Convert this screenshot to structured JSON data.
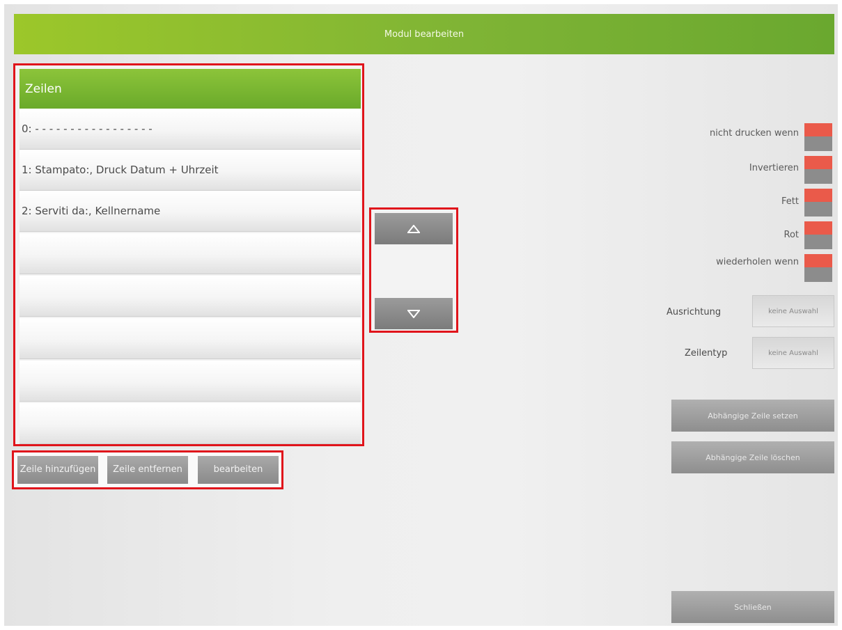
{
  "window": {
    "title": "Modul bearbeiten"
  },
  "lines": {
    "header": "Zeilen",
    "rows": [
      "0: - - - - - - - - - - - - - - - - -",
      "1: Stampato:, Druck Datum + Uhrzeit",
      "2: Serviti da:, Kellnername",
      "",
      "",
      "",
      "",
      ""
    ]
  },
  "row_actions": {
    "add": "Zeile hinzufügen",
    "remove": "Zeile entfernen",
    "edit": "bearbeiten"
  },
  "move_buttons": {
    "up_icon": "chevron-up-icon",
    "down_icon": "chevron-down-icon"
  },
  "options": {
    "toggles": [
      {
        "label": "nicht drucken wenn"
      },
      {
        "label": "Invertieren"
      },
      {
        "label": "Fett"
      },
      {
        "label": "Rot"
      },
      {
        "label": "wiederholen wenn"
      }
    ],
    "toggle_on_color": "#ea5a4a",
    "toggle_off_color": "#8c8c8c",
    "alignment": {
      "label": "Ausrichtung",
      "value": "keine Auswahl"
    },
    "line_type": {
      "label": "Zeilentyp",
      "value": "keine Auswahl"
    },
    "set_dependent": "Abhängige Zeile setzen",
    "delete_dependent": "Abhängige Zeile löschen",
    "close": "Schließen"
  },
  "colors": {
    "accent_green": "#7fb435",
    "highlight_red": "#e0141b"
  }
}
